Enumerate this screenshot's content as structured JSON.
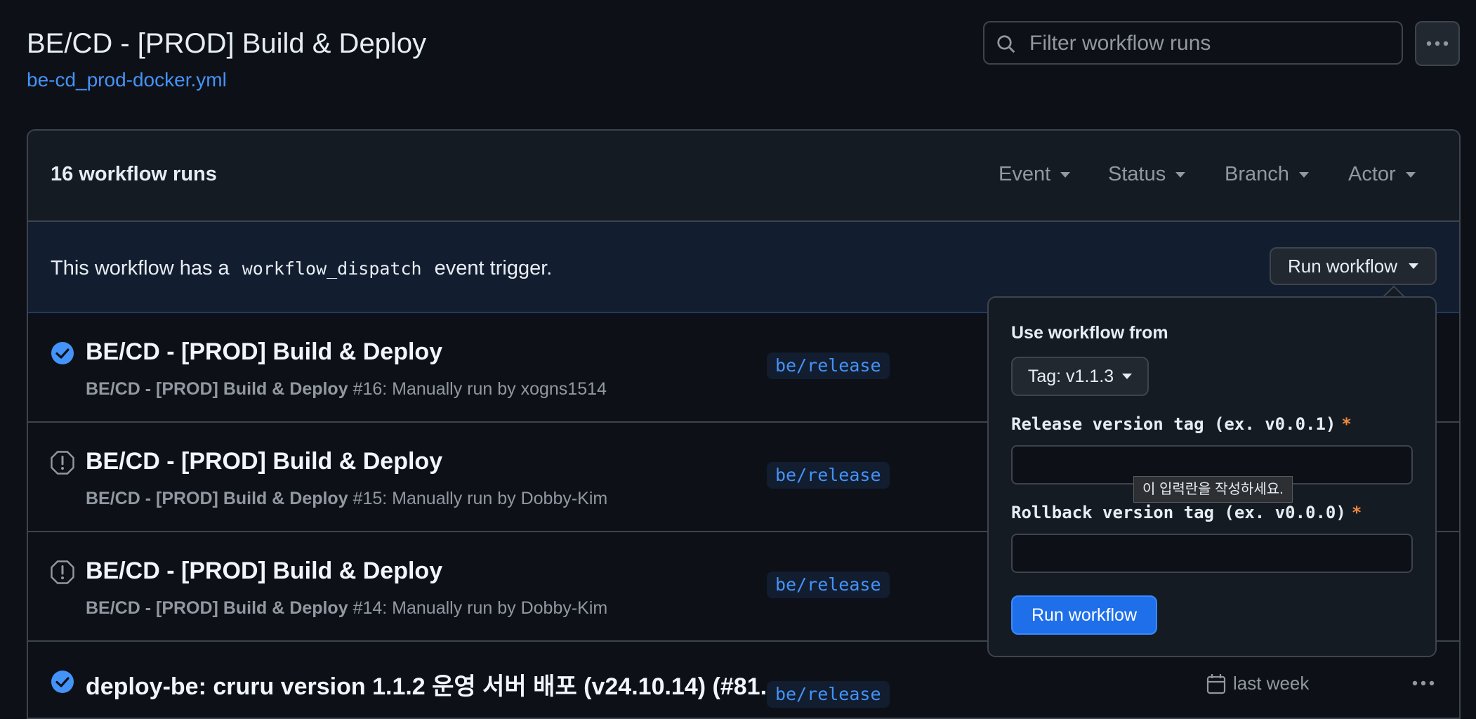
{
  "header": {
    "title": "BE/CD - [PROD] Build & Deploy",
    "file": "be-cd_prod-docker.yml",
    "search_placeholder": "Filter workflow runs"
  },
  "runs_header": {
    "count": "16 workflow runs",
    "filters": [
      "Event",
      "Status",
      "Branch",
      "Actor"
    ]
  },
  "dispatch": {
    "text_before": "This workflow has a",
    "code": "workflow_dispatch",
    "text_after": "event trigger.",
    "button": "Run workflow"
  },
  "runs": [
    {
      "status": "success",
      "title": "BE/CD - [PROD] Build & Deploy",
      "workflow": "BE/CD - [PROD] Build & Deploy",
      "detail": "#16: Manually run by xogns1514",
      "branch": "be/release"
    },
    {
      "status": "cancelled",
      "title": "BE/CD - [PROD] Build & Deploy",
      "workflow": "BE/CD - [PROD] Build & Deploy",
      "detail": "#15: Manually run by Dobby-Kim",
      "branch": "be/release"
    },
    {
      "status": "cancelled",
      "title": "BE/CD - [PROD] Build & Deploy",
      "workflow": "BE/CD - [PROD] Build & Deploy",
      "detail": "#14: Manually run by Dobby-Kim",
      "branch": "be/release"
    },
    {
      "status": "success",
      "title": "deploy-be: cruru version 1.1.2 운영 서버 배포 (v24.10.14) (#81...",
      "workflow": "",
      "detail": "",
      "branch": "be/release",
      "when": "last week"
    }
  ],
  "popover": {
    "heading": "Use workflow from",
    "tag_button": "Tag: v1.1.3",
    "field1_label": "Release version tag (ex. v0.0.1)",
    "field2_label": "Rollback version tag (ex. v0.0.0)",
    "required_mark": "*",
    "tooltip": "이 입력란을 작성하세요.",
    "submit": "Run workflow"
  },
  "colors": {
    "background": "#0d1117",
    "accent_link": "#4493f8",
    "primary_button": "#1f6feb",
    "success": "#4493f8",
    "required": "#f0883e"
  }
}
